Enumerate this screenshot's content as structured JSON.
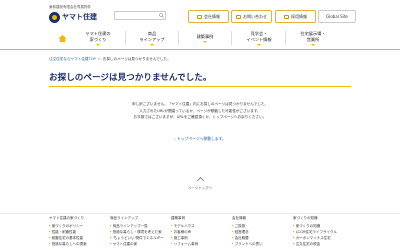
{
  "header": {
    "tagline": "東和建設有限会社専属物件",
    "logo_text": "ヤマト住建",
    "buttons": [
      {
        "label": "会社情報"
      },
      {
        "label": "お問い合わせ"
      },
      {
        "label": "採用情報"
      },
      {
        "label": "Global Site"
      }
    ]
  },
  "nav": {
    "items": [
      {
        "line1": "ヤマト住建の",
        "line2": "家づくり"
      },
      {
        "line1": "商品",
        "line2": "ラインアップ"
      },
      {
        "line1": "建築事例",
        "line2": ""
      },
      {
        "line1": "見学会・",
        "line2": "イベント情報"
      },
      {
        "line1": "住宅展示場・",
        "line2": "営業所"
      }
    ]
  },
  "breadcrumb": {
    "home": "注文住宅ならヤマト住建TOP",
    "separator": ">",
    "current": "お探しのページは見つかりませんでした。"
  },
  "main": {
    "title": "お探しのページは見つかりませんでした。",
    "lines": [
      "申し訳ございません。「ヤマト住建」内にお探しのページは見つかりませんでした。",
      "入力されたURLが間違っているか、ページが移動した可能性がございます。",
      "お手数ではございますが、URLをご確認頂くか、トップページへお戻りください。"
    ],
    "top_link": "トップページへ移動します。",
    "page_top": "ページトップへ"
  },
  "footer": {
    "columns": [
      {
        "heading": "ヤマト住建の家づくり",
        "items": [
          "家づくりのポリシー",
          "性能・耐震性能",
          "耐震住宅の基本性能",
          "快適な暮らしへの提案"
        ]
      },
      {
        "heading": "商品ラインアップ",
        "items": [
          "商品ラインアップ一覧",
          "快適な暮らし・環境を考えた家",
          "'ちょうどいい'物件でエネルギー",
          "ヤマト住建の家"
        ]
      },
      {
        "heading": "建築事例",
        "items": [
          "モデルハウス",
          "お客様の声",
          "施工事例",
          "リフォーム事例"
        ]
      },
      {
        "heading": "会社情報",
        "items": [
          "ご挨拶",
          "経営理念",
          "会社概要",
          "ブランドへの思い"
        ]
      },
      {
        "heading": "家づくりの知識",
        "items": [
          "家づくりの知識",
          "LCCM住宅ライフサイクル",
          "カーボンマイナス住宅",
          "注文住宅の税金"
        ]
      }
    ]
  },
  "colors": {
    "accent": "#f0c000",
    "brand": "#1c2e6e",
    "link": "#1a5fb4"
  }
}
